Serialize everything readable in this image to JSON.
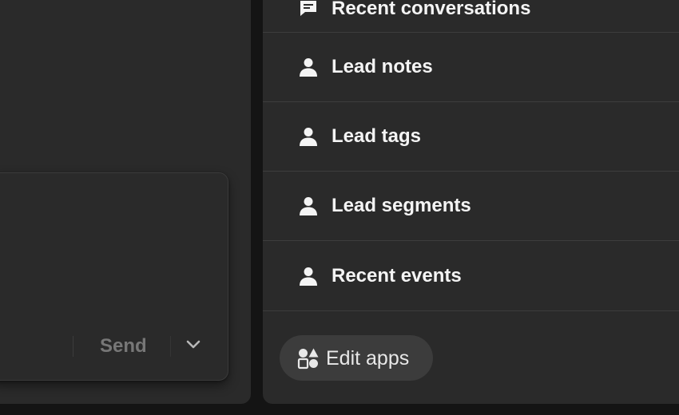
{
  "composer": {
    "send_label": "Send",
    "dropdown_icon": "chevron-down-icon"
  },
  "apps_panel": {
    "items": [
      {
        "label": "Recent conversations",
        "icon": "chat-bubble-icon"
      },
      {
        "label": "Lead notes",
        "icon": "person-icon"
      },
      {
        "label": "Lead tags",
        "icon": "person-icon"
      },
      {
        "label": "Lead segments",
        "icon": "person-icon"
      },
      {
        "label": "Recent events",
        "icon": "person-icon"
      }
    ],
    "edit_apps_label": "Edit apps",
    "edit_apps_icon": "apps-shapes-icon"
  },
  "colors": {
    "background": "#141414",
    "panel": "#2a2a2a",
    "divider": "#3d3d3d",
    "text": "#f4f4f4",
    "muted_text": "#777777",
    "pill": "#3c3c3c"
  }
}
